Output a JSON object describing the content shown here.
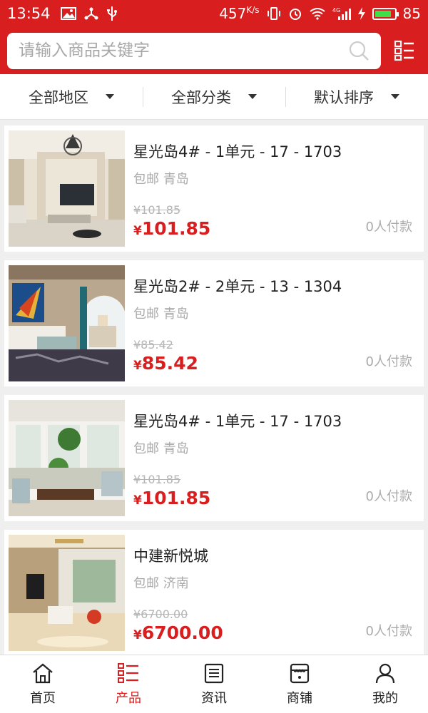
{
  "status": {
    "time": "13:54",
    "network_speed": "457",
    "speed_unit": "K/s",
    "signal_label": "4G",
    "battery": "85"
  },
  "search": {
    "placeholder": "请输入商品关键字"
  },
  "filters": [
    {
      "label": "全部地区"
    },
    {
      "label": "全部分类"
    },
    {
      "label": "默认排序"
    }
  ],
  "products": [
    {
      "title": "星光岛4# - 1单元 - 17 - 1703",
      "shipping": "包邮",
      "city": "青岛",
      "old_price": "¥101.85",
      "currency": "¥",
      "price": "101.85",
      "paid": "0人付款"
    },
    {
      "title": "星光岛2# - 2单元 - 13 - 1304",
      "shipping": "包邮",
      "city": "青岛",
      "old_price": "¥85.42",
      "currency": "¥",
      "price": "85.42",
      "paid": "0人付款"
    },
    {
      "title": "星光岛4# - 1单元 - 17 - 1703",
      "shipping": "包邮",
      "city": "青岛",
      "old_price": "¥101.85",
      "currency": "¥",
      "price": "101.85",
      "paid": "0人付款"
    },
    {
      "title": "中建新悦城",
      "shipping": "包邮",
      "city": "济南",
      "old_price": "¥6700.00",
      "currency": "¥",
      "price": "6700.00",
      "paid": "0人付款"
    }
  ],
  "tabs": [
    {
      "label": "首页",
      "icon": "home-icon"
    },
    {
      "label": "产品",
      "icon": "list-icon"
    },
    {
      "label": "资讯",
      "icon": "news-icon"
    },
    {
      "label": "商铺",
      "icon": "shop-icon"
    },
    {
      "label": "我的",
      "icon": "user-icon"
    }
  ],
  "colors": {
    "brand": "#d81e1e",
    "battery": "#3ee04a"
  }
}
